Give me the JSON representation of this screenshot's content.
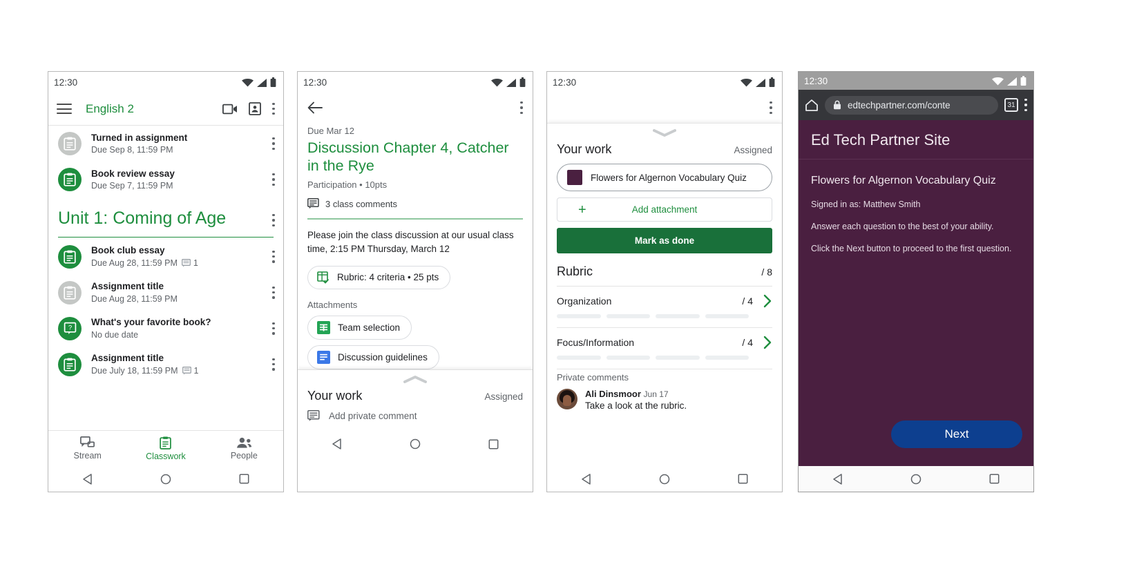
{
  "status_bar": {
    "time": "12:30"
  },
  "phone1": {
    "app_bar": {
      "menu_icon": "hamburger-menu-icon",
      "title": "English 2",
      "meet_icon": "video-camera-icon",
      "folder_icon": "classroom-drive-icon",
      "overflow_icon": "more-vert-icon"
    },
    "top_items": [
      {
        "icon": "assignment-icon",
        "state": "done",
        "title": "Turned in assignment",
        "subtitle": "Due Sep 8, 11:59 PM",
        "comments": ""
      },
      {
        "icon": "assignment-icon",
        "state": "active",
        "title": "Book review essay",
        "subtitle": "Due Sep 7, 11:59 PM",
        "comments": ""
      }
    ],
    "unit": {
      "title": "Unit 1: Coming of Age"
    },
    "unit_items": [
      {
        "icon": "assignment-icon",
        "state": "active",
        "title": "Book club essay",
        "subtitle": "Due Aug 28, 11:59 PM",
        "comments": "1"
      },
      {
        "icon": "assignment-icon",
        "state": "done",
        "title": "Assignment title",
        "subtitle": "Due Aug 28, 11:59 PM",
        "comments": ""
      },
      {
        "icon": "question-icon",
        "state": "active",
        "title": "What's your favorite book?",
        "subtitle": "No due date",
        "comments": ""
      },
      {
        "icon": "assignment-icon",
        "state": "active",
        "title": "Assignment title",
        "subtitle": "Due July 18, 11:59 PM",
        "comments": "1"
      }
    ],
    "tabs": [
      {
        "label": "Stream",
        "icon": "stream-icon",
        "active": false
      },
      {
        "label": "Classwork",
        "icon": "classwork-icon",
        "active": true
      },
      {
        "label": "People",
        "icon": "people-icon",
        "active": false
      }
    ]
  },
  "phone2": {
    "back_icon": "back-arrow-icon",
    "overflow_icon": "more-vert-icon",
    "due": "Due Mar 12",
    "title": "Discussion Chapter 4, Catcher in the Rye",
    "meta": "Participation • 10pts",
    "class_comments": "3 class comments",
    "body": "Please join the class discussion at our usual class time, 2:15 PM Thursday, March 12",
    "rubric_chip": "Rubric: 4 criteria • 25 pts",
    "attachments_label": "Attachments",
    "attachments": [
      {
        "name": "Team selection",
        "type": "sheets"
      },
      {
        "name": "Discussion guidelines",
        "type": "docs"
      }
    ],
    "your_work": "Your work",
    "assigned": "Assigned",
    "private_comment_placeholder": "Add private comment"
  },
  "phone3": {
    "overflow_icon": "more-vert-icon",
    "your_work": "Your work",
    "assigned": "Assigned",
    "work_chip": "Flowers for Algernon Vocabulary Quiz",
    "work_chip_color": "#4a2040",
    "add_attachment": "Add attachment",
    "mark_as_done": "Mark as done",
    "mark_as_done_color": "#19703a",
    "rubric_title": "Rubric",
    "rubric_total": "/ 8",
    "criteria": [
      {
        "name": "Organization",
        "score": "/ 4"
      },
      {
        "name": "Focus/Information",
        "score": "/ 4"
      }
    ],
    "private_comments_label": "Private comments",
    "comment": {
      "author": "Ali Dinsmoor",
      "date": "Jun 17",
      "text": "Take a look at the rubric."
    }
  },
  "phone4": {
    "home_icon": "home-icon",
    "lock_icon": "lock-icon",
    "url": "edtechpartner.com/conte",
    "tab_count": "31",
    "overflow_icon": "more-vert-icon",
    "site_title": "Ed Tech Partner Site",
    "page_bg": "#4a1f40",
    "quiz_title": "Flowers for Algernon Vocabulary Quiz",
    "lines": [
      "Signed in as: Matthew Smith",
      "Answer each question to the best of your ability.",
      "Click the Next button to proceed to the first question."
    ],
    "next_label": "Next",
    "next_color": "#0d3f8f"
  },
  "sys_nav": {
    "back": "back-triangle-icon",
    "home": "home-circle-icon",
    "recents": "recents-square-icon"
  }
}
